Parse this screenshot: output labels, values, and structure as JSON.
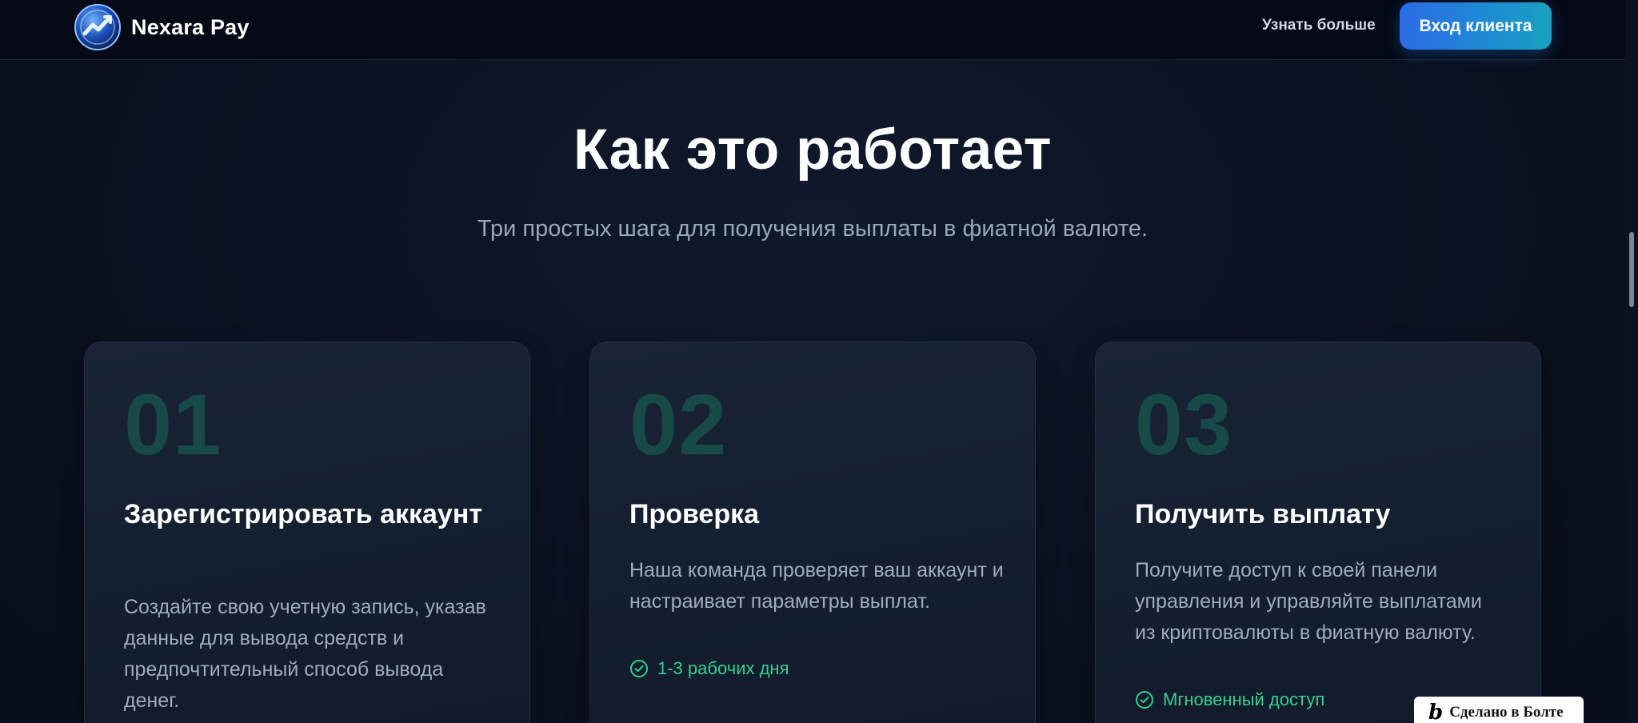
{
  "header": {
    "brand_name": "Nexara Pay",
    "logo_icon": "nexara-logo-icon",
    "nav_learn_more": "Узнать больше",
    "login_button": "Вход клиента"
  },
  "colors": {
    "background": "#0b1120",
    "header_bg": "#060a17",
    "accent_gradient_start": "#2c6be5",
    "accent_gradient_end": "#1aa0c0",
    "step_number": "#174a48",
    "badge_green": "#35d08e"
  },
  "section": {
    "title": "Как это работает",
    "subtitle": "Три простых шага для получения выплаты в фиатной валюте."
  },
  "steps": [
    {
      "number": "01",
      "title": "Зарегистрировать аккаунт",
      "text": "Создайте свою учетную запись, указав данные для вывода средств и предпочтительный способ вывода денег."
    },
    {
      "number": "02",
      "title": "Проверка",
      "text": "Наша команда проверяет ваш аккаунт и настраивает параметры выплат.",
      "badge": "1-3 рабочих дня",
      "badge_icon": "check-circle-icon"
    },
    {
      "number": "03",
      "title": "Получить выплату",
      "text": "Получите доступ к своей панели управления и управляйте выплатами из криптовалюты в фиатную валюту.",
      "badge": "Мгновенный доступ",
      "badge_icon": "check-circle-icon"
    }
  ],
  "made_badge": {
    "logo": "b",
    "text": "Сделано в Болте"
  }
}
